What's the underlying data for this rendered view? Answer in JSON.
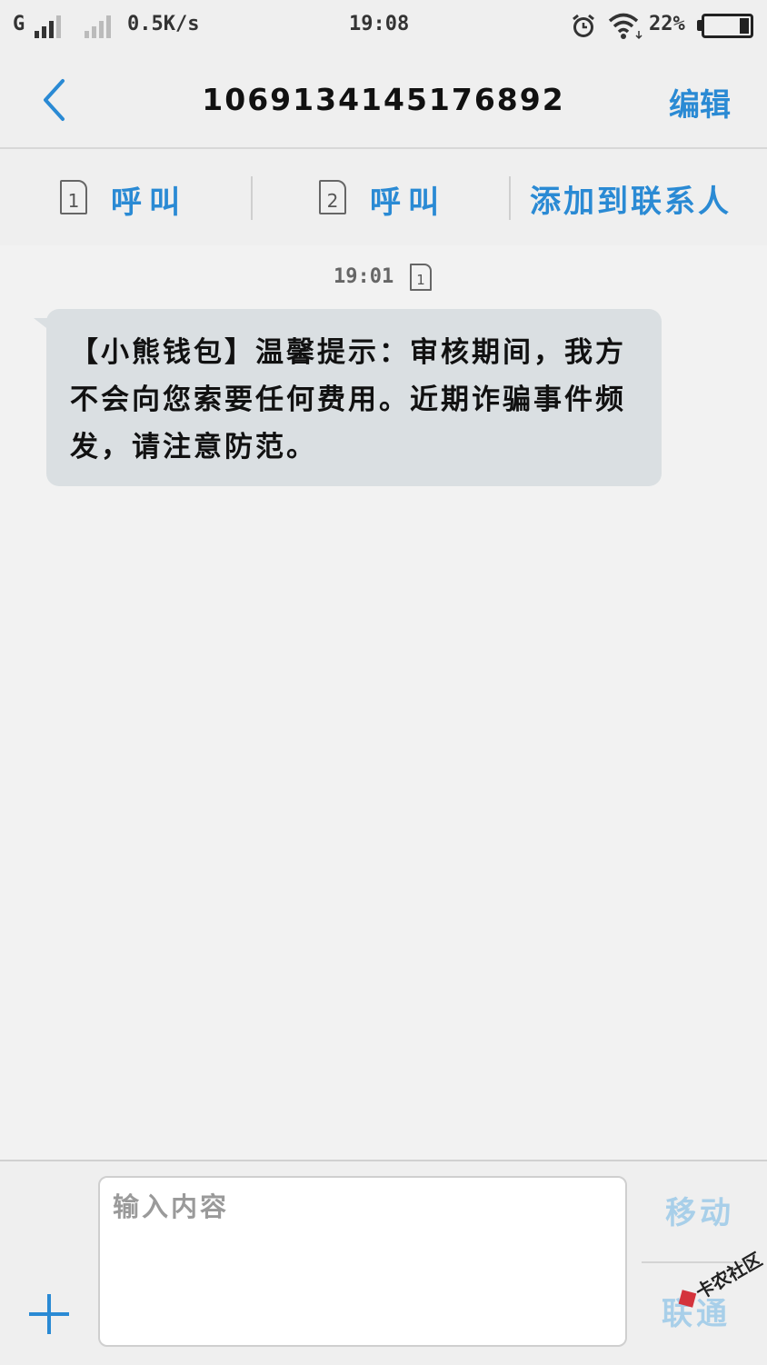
{
  "status_bar": {
    "network": "G",
    "speed": "0.5K/s",
    "time": "19:08",
    "battery": "22%",
    "battery_level": 0.22
  },
  "header": {
    "title": "1069134145176892",
    "edit_label": "编辑"
  },
  "actions": {
    "sim1_number": "1",
    "sim1_call_label": "呼叫",
    "sim2_number": "2",
    "sim2_call_label": "呼叫",
    "add_contact_label": "添加到联系人"
  },
  "conversation": {
    "message_time": "19:01",
    "message_sim": "1",
    "message_text": "【小熊钱包】温馨提示：审核期间，我方不会向您索要任何费用。近期诈骗事件频发，请注意防范。"
  },
  "composer": {
    "placeholder": "输入内容",
    "send_sim1_label": "移动",
    "send_sim2_label": "联通"
  },
  "watermark": {
    "text": "卡农社区"
  },
  "colors": {
    "accent": "#2a8ad4",
    "accent_disabled": "#a8cfe9",
    "bubble": "#dadfe2",
    "background": "#f2f2f2"
  }
}
